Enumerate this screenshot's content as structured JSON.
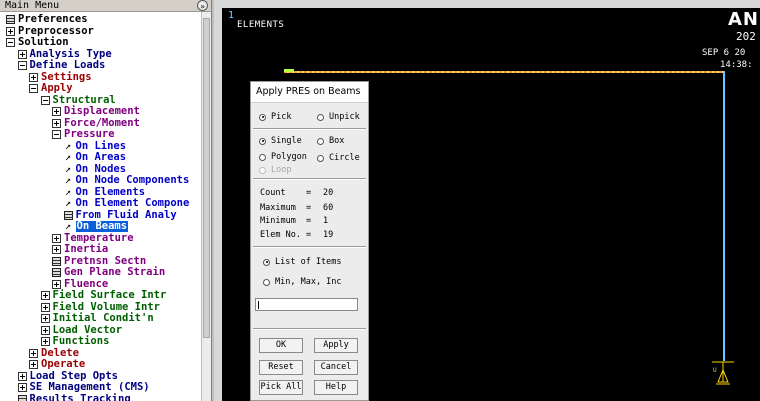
{
  "main_menu": {
    "title": "Main Menu",
    "collapse_glyph": "»",
    "items": [
      {
        "label": "Preferences",
        "icon": "grid-icon",
        "color": "black",
        "level": 0
      },
      {
        "label": "Preprocessor",
        "icon": "plus-box-icon",
        "color": "black",
        "level": 0
      },
      {
        "label": "Solution",
        "icon": "minus-box-icon",
        "color": "black",
        "level": 0
      },
      {
        "label": "Analysis Type",
        "icon": "plus-box-icon",
        "color": "navy",
        "level": 1
      },
      {
        "label": "Define Loads",
        "icon": "minus-box-icon",
        "color": "navy",
        "level": 1
      },
      {
        "label": "Settings",
        "icon": "plus-box-icon",
        "color": "maroon",
        "level": 2
      },
      {
        "label": "Apply",
        "icon": "minus-box-icon",
        "color": "maroon",
        "level": 2
      },
      {
        "label": "Structural",
        "icon": "minus-box-icon",
        "color": "green",
        "level": 3
      },
      {
        "label": "Displacement",
        "icon": "plus-box-icon",
        "color": "purple",
        "level": 4
      },
      {
        "label": "Force/Moment",
        "icon": "plus-box-icon",
        "color": "purple",
        "level": 4
      },
      {
        "label": "Pressure",
        "icon": "minus-box-icon",
        "color": "purple",
        "level": 4
      },
      {
        "label": "On Lines",
        "icon": "arrow-icon",
        "color": "blue",
        "level": 5
      },
      {
        "label": "On Areas",
        "icon": "arrow-icon",
        "color": "blue",
        "level": 5
      },
      {
        "label": "On Nodes",
        "icon": "arrow-icon",
        "color": "blue",
        "level": 5
      },
      {
        "label": "On Node Components",
        "icon": "arrow-icon",
        "color": "blue",
        "level": 5
      },
      {
        "label": "On Elements",
        "icon": "arrow-icon",
        "color": "blue",
        "level": 5
      },
      {
        "label": "On Element Compone",
        "icon": "arrow-icon",
        "color": "blue",
        "level": 5
      },
      {
        "label": "From Fluid Analy",
        "icon": "grid-icon",
        "color": "blue",
        "level": 5
      },
      {
        "label": "On Beams",
        "icon": "arrow-icon",
        "color": "blue",
        "level": 5,
        "selected": true
      },
      {
        "label": "Temperature",
        "icon": "plus-box-icon",
        "color": "purple",
        "level": 4
      },
      {
        "label": "Inertia",
        "icon": "plus-box-icon",
        "color": "purple",
        "level": 4
      },
      {
        "label": "Pretnsn Sectn",
        "icon": "grid-icon",
        "color": "purple",
        "level": 4
      },
      {
        "label": "Gen Plane Strain",
        "icon": "grid-icon",
        "color": "purple",
        "level": 4
      },
      {
        "label": "Fluence",
        "icon": "plus-box-icon",
        "color": "purple",
        "level": 4
      },
      {
        "label": "Field Surface Intr",
        "icon": "plus-box-icon",
        "color": "green",
        "level": 3
      },
      {
        "label": "Field Volume Intr",
        "icon": "plus-box-icon",
        "color": "green",
        "level": 3
      },
      {
        "label": "Initial Condit'n",
        "icon": "plus-box-icon",
        "color": "green",
        "level": 3
      },
      {
        "label": "Load Vector",
        "icon": "plus-box-icon",
        "color": "green",
        "level": 3
      },
      {
        "label": "Functions",
        "icon": "plus-box-icon",
        "color": "green",
        "level": 3
      },
      {
        "label": "Delete",
        "icon": "plus-box-icon",
        "color": "maroon",
        "level": 2
      },
      {
        "label": "Operate",
        "icon": "plus-box-icon",
        "color": "maroon",
        "level": 2
      },
      {
        "label": "Load Step Opts",
        "icon": "plus-box-icon",
        "color": "navy",
        "level": 1
      },
      {
        "label": "SE Management (CMS)",
        "icon": "plus-box-icon",
        "color": "navy",
        "level": 1
      },
      {
        "label": "Results Tracking",
        "icon": "grid-icon",
        "color": "navy",
        "level": 1
      }
    ]
  },
  "graphics": {
    "window_number": "1",
    "plot_label": "ELEMENTS",
    "brand": "ANS",
    "version": "202",
    "date": "SEP  6 20",
    "time": "14:38:"
  },
  "dialog": {
    "title": "Apply PRES on Beams",
    "pick_options": [
      {
        "label": "Pick",
        "selected": true
      },
      {
        "label": "Unpick",
        "selected": false
      }
    ],
    "mode_options": [
      {
        "label": "Single",
        "selected": true
      },
      {
        "label": "Box",
        "selected": false
      },
      {
        "label": "Polygon",
        "selected": false
      },
      {
        "label": "Circle",
        "selected": false
      },
      {
        "label": "Loop",
        "selected": false,
        "disabled": true
      }
    ],
    "stats": [
      {
        "label": "Count",
        "value": "20"
      },
      {
        "label": "Maximum",
        "value": "60"
      },
      {
        "label": "Minimum",
        "value": "1"
      },
      {
        "label": "Elem No.",
        "value": "19"
      }
    ],
    "input_options": [
      {
        "label": "List of Items",
        "selected": true
      },
      {
        "label": "Min, Max, Inc",
        "selected": false
      }
    ],
    "input_value": "",
    "buttons": [
      "OK",
      "Apply",
      "Reset",
      "Cancel",
      "Pick All",
      "Help"
    ]
  },
  "colors": {
    "tree_black": "#000000",
    "tree_navy": "#000080",
    "tree_maroon": "#9a0000",
    "tree_green": "#006000",
    "tree_purple": "#800080",
    "tree_blue": "#0000c8",
    "selection": "#0a5fd8",
    "beam": "#ff9a2a",
    "beam_vertical": "#69c8ff"
  }
}
